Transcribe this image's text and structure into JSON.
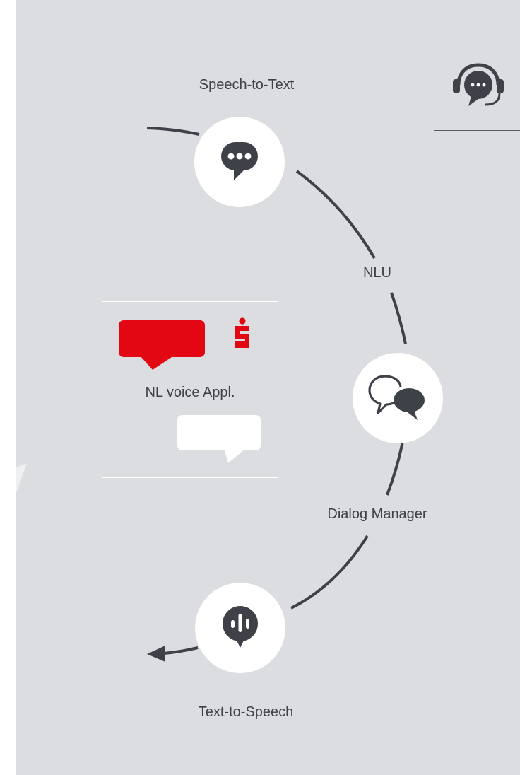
{
  "labels": {
    "speech_to_text": "Speech-to-Text",
    "nlu": "NLU",
    "dialog_manager": "Dialog Manager",
    "text_to_speech": "Text-to-Speech"
  },
  "app": {
    "label": "NL voice Appl."
  },
  "icons": {
    "speech_to_text": "chat-dots-icon",
    "dialog_manager": "conversation-bubbles-icon",
    "text_to_speech": "audio-bubble-icon",
    "headset": "headset-chat-icon",
    "brand": "sparkasse-logo"
  },
  "colors": {
    "background": "#dcdde0",
    "line": "#3e4147",
    "node": "#ffffff",
    "brand_red": "#e30613"
  }
}
